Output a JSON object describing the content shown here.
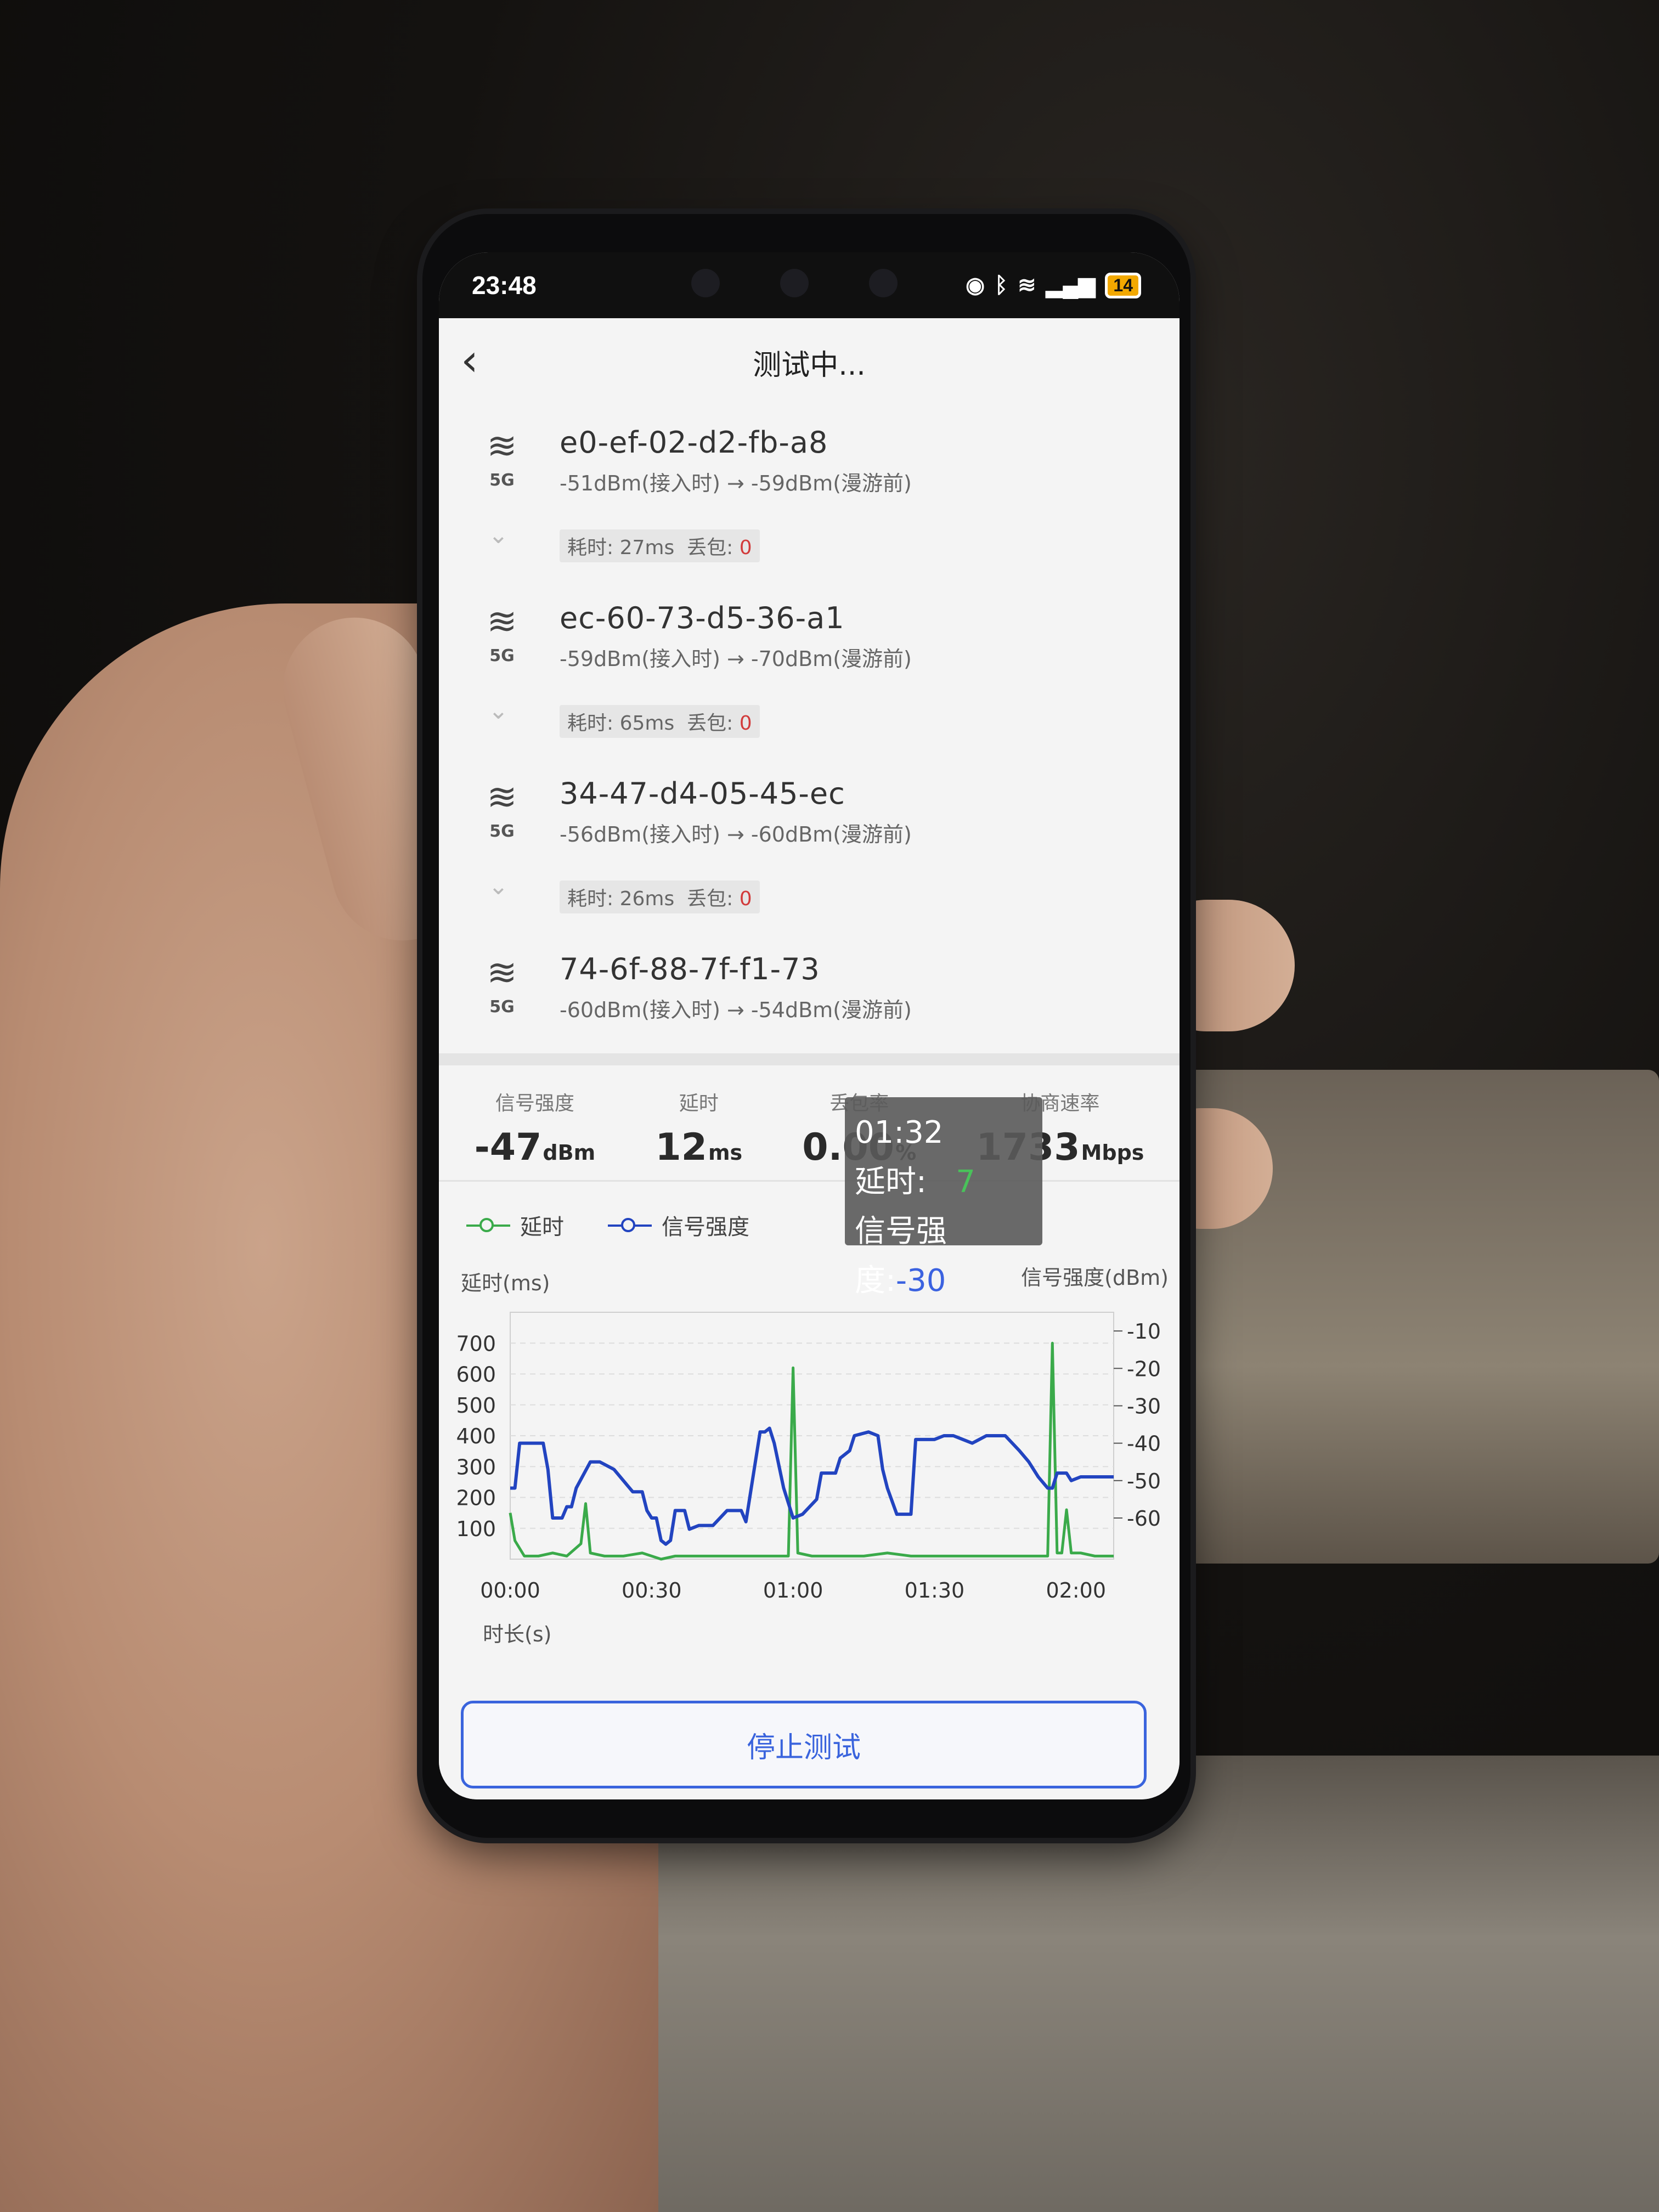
{
  "status_bar": {
    "time": "23:48",
    "battery": "14"
  },
  "header": {
    "title": "测试中..."
  },
  "access_points": [
    {
      "mac": "e0-ef-02-d2-fb-a8",
      "band": "5G",
      "rssi": "-51dBm(接入时) → -59dBm(漫游前)"
    },
    {
      "mac": "ec-60-73-d5-36-a1",
      "band": "5G",
      "rssi": "-59dBm(接入时) → -70dBm(漫游前)"
    },
    {
      "mac": "34-47-d4-05-45-ec",
      "band": "5G",
      "rssi": "-56dBm(接入时) → -60dBm(漫游前)"
    },
    {
      "mac": "74-6f-88-7f-f1-73",
      "band": "5G",
      "rssi": "-60dBm(接入时) → -54dBm(漫游前)"
    }
  ],
  "hops": [
    {
      "time_label": "耗时: 27ms",
      "loss_label": "丢包: ",
      "loss": "0"
    },
    {
      "time_label": "耗时: 65ms",
      "loss_label": "丢包: ",
      "loss": "0"
    },
    {
      "time_label": "耗时: 26ms",
      "loss_label": "丢包: ",
      "loss": "0"
    }
  ],
  "stats": {
    "signal": {
      "label": "信号强度",
      "value": "-47",
      "unit": "dBm"
    },
    "latency": {
      "label": "延时",
      "value": "12",
      "unit": "ms"
    },
    "loss": {
      "label": "丢包率",
      "value": "0.00",
      "unit": "%"
    },
    "rate": {
      "label": "协商速率",
      "value": "1733",
      "unit": "Mbps"
    }
  },
  "chart_data": {
    "type": "line",
    "legend": [
      "延时",
      "信号强度"
    ],
    "y_left_label": "延时(ms)",
    "y_right_label": "信号强度(dBm)",
    "x_label": "时长(s)",
    "x_ticks": [
      "00:00",
      "00:30",
      "01:00",
      "01:30",
      "02:00"
    ],
    "y_left_ticks": [
      100,
      200,
      300,
      400,
      500,
      600,
      700
    ],
    "y_right_ticks": [
      -10,
      -20,
      -30,
      -40,
      -50,
      -60
    ],
    "x_seconds_range": [
      0,
      128
    ],
    "y_left_range": [
      0,
      800
    ],
    "y_right_range": [
      -71,
      -5
    ],
    "colors": {
      "latency": "#3aaa4a",
      "signal": "#2244c0"
    },
    "series": [
      {
        "name": "延时",
        "points": [
          [
            0,
            150
          ],
          [
            1,
            60
          ],
          [
            3,
            10
          ],
          [
            6,
            10
          ],
          [
            9,
            20
          ],
          [
            12,
            10
          ],
          [
            15,
            50
          ],
          [
            16,
            180
          ],
          [
            17,
            20
          ],
          [
            20,
            10
          ],
          [
            24,
            10
          ],
          [
            28,
            20
          ],
          [
            30,
            10
          ],
          [
            32,
            0
          ],
          [
            35,
            10
          ],
          [
            40,
            10
          ],
          [
            45,
            10
          ],
          [
            50,
            10
          ],
          [
            55,
            10
          ],
          [
            59,
            10
          ],
          [
            60,
            620
          ],
          [
            61,
            20
          ],
          [
            64,
            10
          ],
          [
            70,
            10
          ],
          [
            75,
            10
          ],
          [
            80,
            20
          ],
          [
            85,
            10
          ],
          [
            90,
            10
          ],
          [
            95,
            10
          ],
          [
            100,
            10
          ],
          [
            105,
            10
          ],
          [
            110,
            10
          ],
          [
            114,
            10
          ],
          [
            115,
            700
          ],
          [
            116,
            20
          ],
          [
            117,
            20
          ],
          [
            118,
            160
          ],
          [
            119,
            20
          ],
          [
            121,
            20
          ],
          [
            124,
            10
          ],
          [
            128,
            10
          ]
        ]
      },
      {
        "name": "信号强度",
        "points": [
          [
            0,
            -52
          ],
          [
            1,
            -52
          ],
          [
            2,
            -40
          ],
          [
            7,
            -40
          ],
          [
            8,
            -47
          ],
          [
            9,
            -60
          ],
          [
            11,
            -60
          ],
          [
            12,
            -57
          ],
          [
            13,
            -57
          ],
          [
            14,
            -52
          ],
          [
            17,
            -45
          ],
          [
            19,
            -45
          ],
          [
            22,
            -47
          ],
          [
            24,
            -50
          ],
          [
            26,
            -53
          ],
          [
            28,
            -53
          ],
          [
            29,
            -58
          ],
          [
            30,
            -60
          ],
          [
            31,
            -60
          ],
          [
            32,
            -66
          ],
          [
            33,
            -67
          ],
          [
            34,
            -66
          ],
          [
            35,
            -58
          ],
          [
            37,
            -58
          ],
          [
            38,
            -63
          ],
          [
            40,
            -62
          ],
          [
            43,
            -62
          ],
          [
            46,
            -58
          ],
          [
            49,
            -58
          ],
          [
            50,
            -61
          ],
          [
            52,
            -45
          ],
          [
            53,
            -37
          ],
          [
            54,
            -37
          ],
          [
            55,
            -36
          ],
          [
            56,
            -40
          ],
          [
            58,
            -52
          ],
          [
            60,
            -60
          ],
          [
            62,
            -59
          ],
          [
            65,
            -55
          ],
          [
            66,
            -48
          ],
          [
            69,
            -48
          ],
          [
            70,
            -44
          ],
          [
            72,
            -42
          ],
          [
            73,
            -38
          ],
          [
            76,
            -37
          ],
          [
            78,
            -38
          ],
          [
            79,
            -47
          ],
          [
            80,
            -52
          ],
          [
            82,
            -59
          ],
          [
            85,
            -59
          ],
          [
            86,
            -39
          ],
          [
            88,
            -39
          ],
          [
            90,
            -39
          ],
          [
            92,
            -38
          ],
          [
            94,
            -38
          ],
          [
            96,
            -39
          ],
          [
            98,
            -40
          ],
          [
            101,
            -38
          ],
          [
            103,
            -38
          ],
          [
            105,
            -38
          ],
          [
            108,
            -42
          ],
          [
            110,
            -45
          ],
          [
            112,
            -49
          ],
          [
            114,
            -52
          ],
          [
            115,
            -52
          ],
          [
            116,
            -48
          ],
          [
            118,
            -48
          ],
          [
            119,
            -50
          ],
          [
            121,
            -49
          ],
          [
            125,
            -49
          ],
          [
            128,
            -49
          ]
        ]
      }
    ],
    "tooltip": {
      "time": "01:32",
      "latency_label": "延时:",
      "latency_value": "7",
      "signal_label": "信号强度:",
      "signal_value": "-30"
    }
  },
  "stop_button": {
    "label": "停止测试"
  }
}
